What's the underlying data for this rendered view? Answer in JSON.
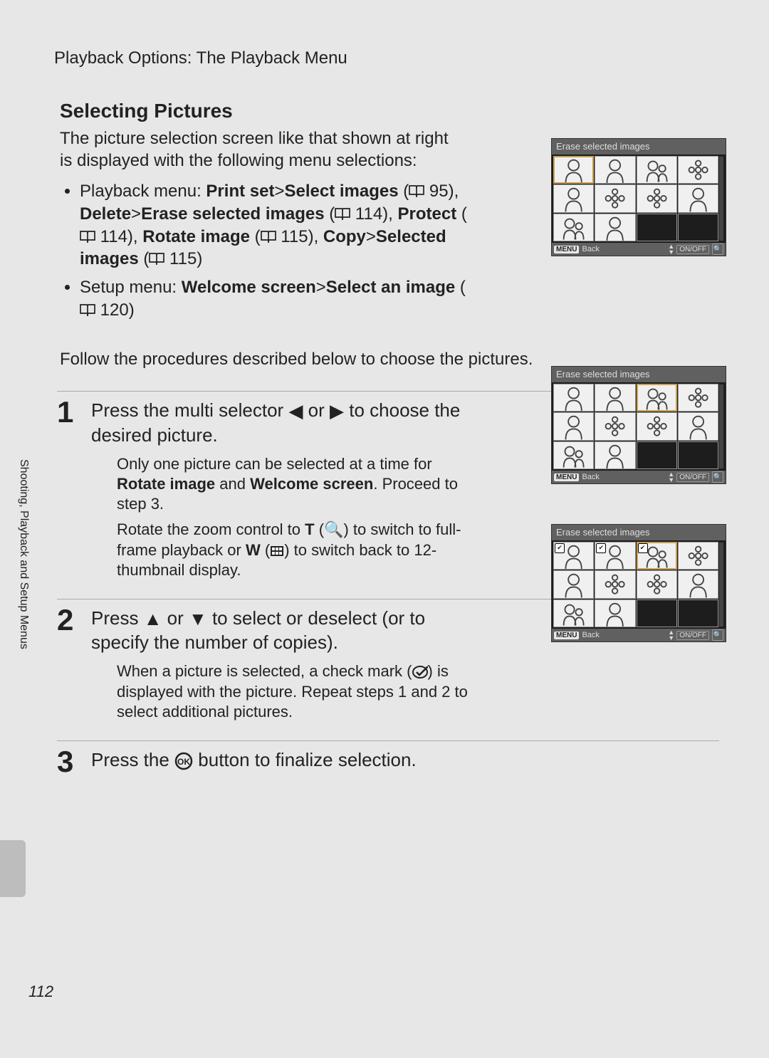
{
  "header": "Playback Options: The Playback Menu",
  "section_title": "Selecting Pictures",
  "intro": "The picture selection screen like that shown at right is displayed with the following menu selections:",
  "bullet1": {
    "prefix": "Playback menu: ",
    "b1": "Print set",
    "gt1": ">",
    "b2": "Select images",
    "p1": " 95), ",
    "b3": "Delete",
    "gt2": ">",
    "b4": "Erase selected images",
    "p2": " 114), ",
    "b5": "Protect",
    "p3": " 114), ",
    "b6": "Rotate image",
    "p4": " 115), ",
    "b7": "Copy",
    "gt3": ">",
    "b8": "Selected images",
    "p5": " 115)"
  },
  "bullet2": {
    "prefix": "Setup menu: ",
    "b1": "Welcome screen",
    "gt1": ">",
    "b2": "Select an image",
    "p1": " 120)"
  },
  "follow": "Follow the procedures described below to choose the pictures.",
  "steps": {
    "s1": {
      "num": "1",
      "title_a": "Press the multi selector ",
      "title_b": " or ",
      "title_c": " to choose the desired picture.",
      "detail1a": "Only one picture can be selected at a time for ",
      "detail1b": "Rotate image",
      "detail1c": " and ",
      "detail1d": "Welcome screen",
      "detail1e": ". Proceed to step 3.",
      "detail2a": "Rotate the zoom control to ",
      "detail2b": "T",
      "detail2c": " (",
      "detail2d": ") to switch to full-frame playback or ",
      "detail2e": "W",
      "detail2f": " (",
      "detail2g": ") to switch back to 12-thumbnail display."
    },
    "s2": {
      "num": "2",
      "title_a": "Press ",
      "title_b": " or ",
      "title_c": " to select or deselect (or to specify the number of copies).",
      "detail_a": "When a picture is selected, a check mark (",
      "detail_b": ") is displayed with the picture. Repeat steps 1 and 2 to select additional pictures."
    },
    "s3": {
      "num": "3",
      "title_a": "Press the ",
      "title_b": " button to finalize selection."
    }
  },
  "shot": {
    "title": "Erase selected images",
    "menu": "MENU",
    "back": "Back",
    "onoff": "ON/OFF",
    "mag": "🔍"
  },
  "sidebar": "Shooting, Playback and Setup Menus",
  "page_number": "112"
}
